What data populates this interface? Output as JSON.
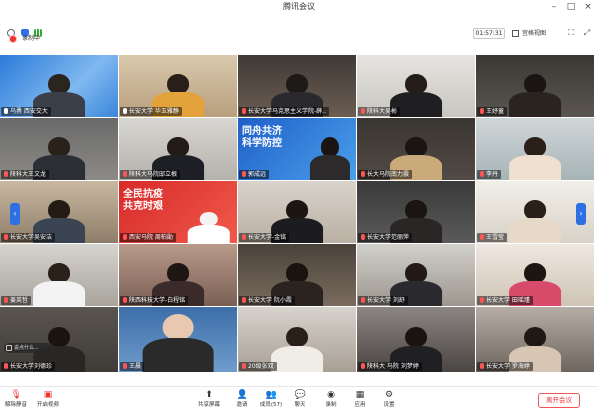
{
  "window": {
    "title": "腾讯会议"
  },
  "toolbar_top": {
    "timer": "01:57:31",
    "view_label": "宫格视图",
    "icons": [
      "info-icon",
      "shield-icon",
      "signal-icon",
      "grid-view-icon",
      "fullscreen-icon",
      "exit-fullscreen-icon"
    ]
  },
  "recording": {
    "label": "录制中"
  },
  "participants": [
    {
      "name": "乌勇 西安交大",
      "mic": "on"
    },
    {
      "name": "长安大学 华玉雅静",
      "mic": "on"
    },
    {
      "name": "长安大学马克思主义学院-薛..",
      "mic": "off"
    },
    {
      "name": "陕科大吴彬",
      "mic": "off"
    },
    {
      "name": "王妤童",
      "mic": "off"
    },
    {
      "name": "陕科大王文龙",
      "mic": "off"
    },
    {
      "name": "陕科大马院邸立根",
      "mic": "off"
    },
    {
      "name": "郭成远",
      "mic": "off"
    },
    {
      "name": "长大马院南力震",
      "mic": "off"
    },
    {
      "name": "李丹",
      "mic": "off"
    },
    {
      "name": "长安大学吴安洁",
      "mic": "off"
    },
    {
      "name": "西安马院 周柏勛",
      "mic": "off"
    },
    {
      "name": "长安大学-金铭",
      "mic": "off"
    },
    {
      "name": "长安大学范丽萍",
      "mic": "off"
    },
    {
      "name": "王雪莹",
      "mic": "off"
    },
    {
      "name": "姜英哲",
      "mic": "off"
    },
    {
      "name": "陕西科技大学-白程铭",
      "mic": "off"
    },
    {
      "name": "长安大学 阮小霞",
      "mic": "off"
    },
    {
      "name": "长安大学 刘舒",
      "mic": "off"
    },
    {
      "name": "长安大学 田瑶瑾",
      "mic": "off"
    },
    {
      "name": "长安大学刘德珍",
      "mic": "off"
    },
    {
      "name": "王晨",
      "mic": "off"
    },
    {
      "name": "20级张双",
      "mic": "off"
    },
    {
      "name": "陕科大 马院 刘梦婷",
      "mic": "off"
    },
    {
      "name": "长安大学 罗海婷",
      "mic": "off"
    }
  ],
  "posters": [
    {
      "text": "同舟共济\n科学防控"
    },
    {
      "text": "全民抗疫\n共克时艰"
    }
  ],
  "chat": {
    "preview": "说点什么..."
  },
  "bottom_toolbar": {
    "mute": "解除静音",
    "video": "开启视频",
    "share": "共享屏幕",
    "invite": "邀请",
    "members": "成员(57)",
    "chat": "聊天",
    "record": "录制",
    "apps": "应用",
    "settings": "设置",
    "end": "离开会议"
  },
  "colors": {
    "accent": "#2f6fe4",
    "danger": "#e33333",
    "poster_red": "#d72a2a",
    "poster_blue": "#1f5fc8"
  }
}
